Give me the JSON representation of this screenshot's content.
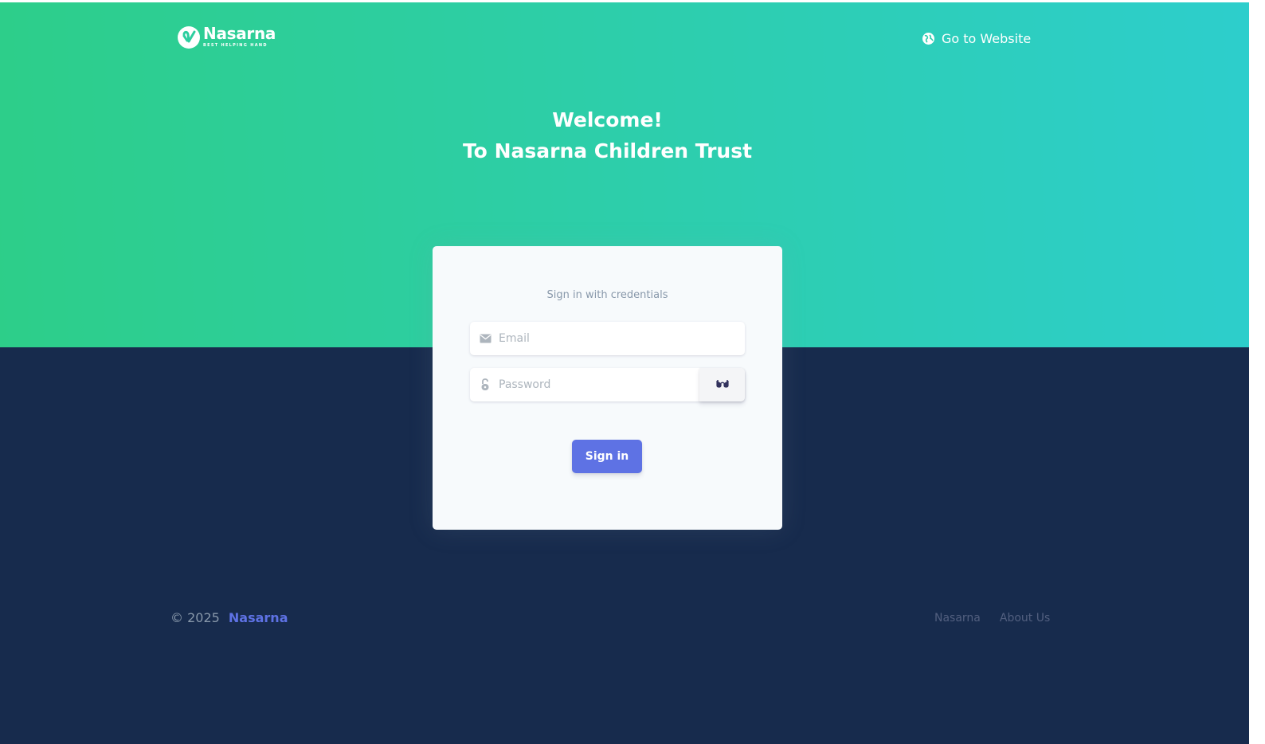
{
  "brand": {
    "name": "Nasarna",
    "tagline": "BEST HELPING HAND",
    "logo_icon": "heart-check-icon"
  },
  "nav": {
    "website_link_label": "Go to Website",
    "website_link_icon": "globe-icon"
  },
  "hero": {
    "line1": "Welcome!",
    "line2": "To Nasarna Children Trust"
  },
  "login": {
    "caption": "Sign in with credentials",
    "email_placeholder": "Email",
    "email_icon": "envelope-icon",
    "password_placeholder": "Password",
    "password_icon": "lock-open-icon",
    "toggle_icon": "glasses-icon",
    "submit_label": "Sign in"
  },
  "footer": {
    "copyright_prefix": "© 2025",
    "copyright_brand": "Nasarna",
    "links": [
      "Nasarna",
      "About Us"
    ]
  },
  "colors": {
    "gradient_start": "#2dce89",
    "gradient_end": "#2dcecc",
    "page_background": "#172b4d",
    "primary": "#5e72e4",
    "card_background": "#f7fafc"
  }
}
